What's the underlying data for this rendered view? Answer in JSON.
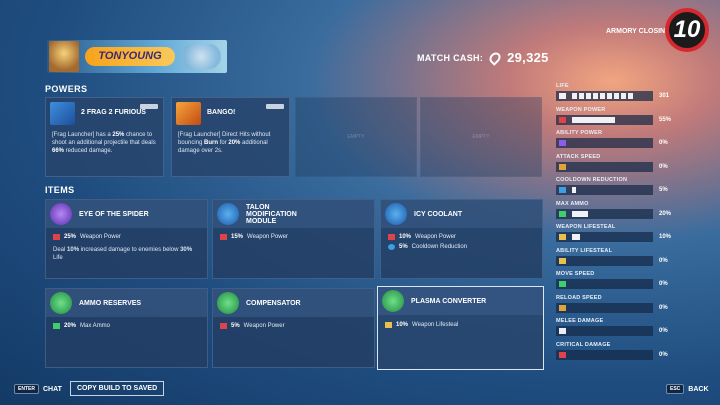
{
  "header": {
    "player_name": "TONYOUNG",
    "match_cash_label": "MATCH CASH:",
    "match_cash_value": "29,325",
    "armory_label": "ARMORY CLOSING IN",
    "armory_timer": "10"
  },
  "powers": {
    "title": "POWERS",
    "cards": [
      {
        "name": "2 FRAG 2 FURIOUS",
        "desc_pre": "[Frag Launcher] has a ",
        "desc_b1": "25%",
        "desc_mid": " chance to shoot an additional projectile that deals ",
        "desc_b2": "66%",
        "desc_post": " reduced damage."
      },
      {
        "name": "BANGO!",
        "desc_pre": "[Frag Launcher] Direct Hits without bouncing ",
        "desc_b1": "Burn",
        "desc_mid": " for ",
        "desc_b2": "20%",
        "desc_post": " additional damage over 2s."
      }
    ],
    "empty_slots": [
      "EMPTY",
      "EMPTY"
    ]
  },
  "items": {
    "title": "ITEMS",
    "cards": [
      {
        "name": "EYE OF THE SPIDER",
        "stats": [
          {
            "value": "25%",
            "label": "Weapon Power"
          }
        ],
        "extra_pre": "Deal ",
        "extra_b": "10%",
        "extra_mid": " increased damage to enemies below ",
        "extra_b2": "30%",
        "extra_post": " Life"
      },
      {
        "name": "TALON MODIFICATION MODULE",
        "stats": [
          {
            "value": "15%",
            "label": "Weapon Power"
          }
        ]
      },
      {
        "name": "ICY COOLANT",
        "stats": [
          {
            "value": "10%",
            "label": "Weapon Power"
          },
          {
            "value": "5%",
            "label": "Cooldown Reduction"
          }
        ]
      },
      {
        "name": "AMMO RESERVES",
        "stats": [
          {
            "value": "20%",
            "label": "Max Ammo"
          }
        ]
      },
      {
        "name": "COMPENSATOR",
        "stats": [
          {
            "value": "5%",
            "label": "Weapon Power"
          }
        ]
      },
      {
        "name": "PLASMA CONVERTER",
        "stats": [
          {
            "value": "10%",
            "label": "Weapon Lifesteal"
          }
        ]
      }
    ]
  },
  "stats": [
    {
      "label": "LIFE",
      "value": "301",
      "fill": 0.88
    },
    {
      "label": "WEAPON POWER",
      "value": "55%",
      "fill": 0.55
    },
    {
      "label": "ABILITY POWER",
      "value": "0%",
      "fill": 0
    },
    {
      "label": "ATTACK SPEED",
      "value": "0%",
      "fill": 0
    },
    {
      "label": "COOLDOWN REDUCTION",
      "value": "5%",
      "fill": 0.05
    },
    {
      "label": "MAX AMMO",
      "value": "20%",
      "fill": 0.2
    },
    {
      "label": "WEAPON LIFESTEAL",
      "value": "10%",
      "fill": 0.1
    },
    {
      "label": "ABILITY LIFESTEAL",
      "value": "0%",
      "fill": 0
    },
    {
      "label": "MOVE SPEED",
      "value": "0%",
      "fill": 0
    },
    {
      "label": "RELOAD SPEED",
      "value": "0%",
      "fill": 0
    },
    {
      "label": "MELEE DAMAGE",
      "value": "0%",
      "fill": 0
    },
    {
      "label": "CRITICAL DAMAGE",
      "value": "0%",
      "fill": 0
    }
  ],
  "footer": {
    "enter_key": "ENTER",
    "chat_label": "CHAT",
    "copy_build_label": "COPY BUILD TO SAVED",
    "esc_key": "ESC",
    "back_label": "BACK"
  },
  "colors": {
    "weapon_power": "#e0424a",
    "ability_power": "#8a5cf0",
    "attack_speed": "#e2a23a",
    "cooldown": "#3aa0e0",
    "max_ammo": "#3fcf6a",
    "lifesteal": "#e8c04a",
    "timer_ring": "#d7282f"
  }
}
